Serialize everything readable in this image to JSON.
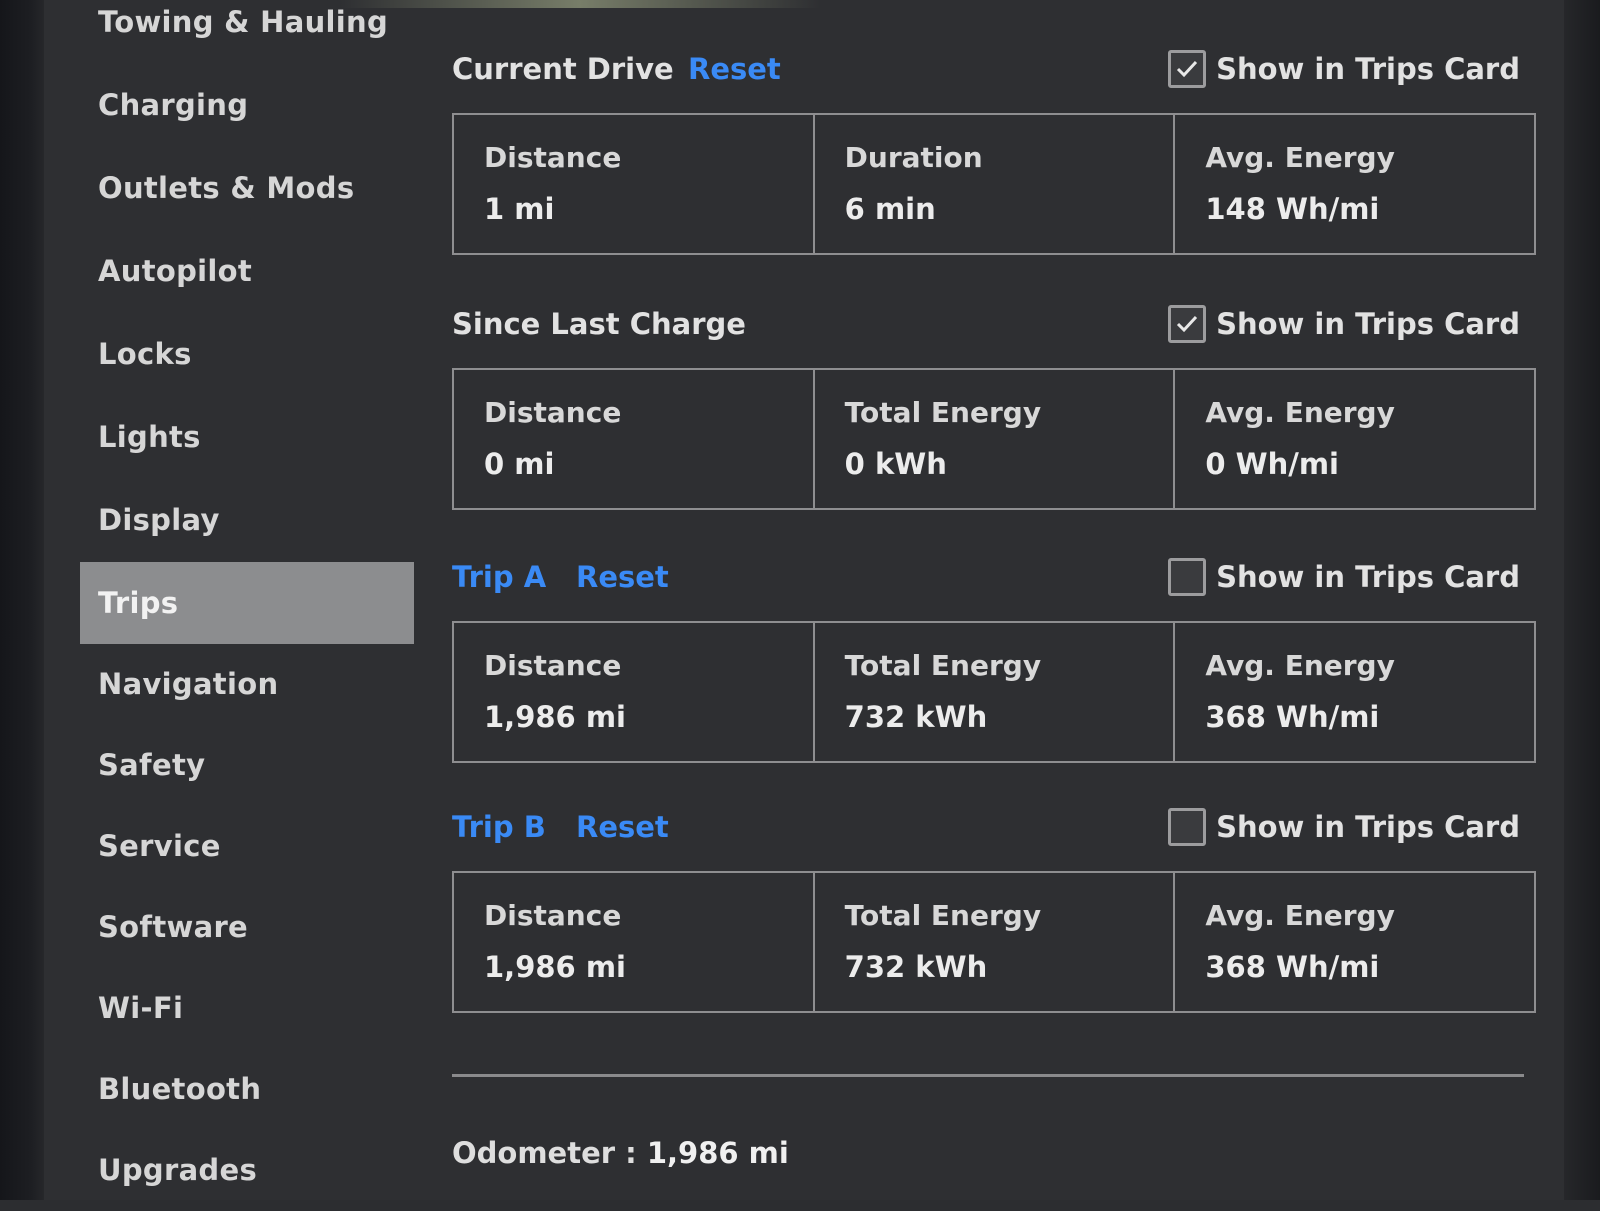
{
  "sidebar": {
    "items": [
      {
        "label": "Towing & Hauling",
        "active": false
      },
      {
        "label": "Charging",
        "active": false
      },
      {
        "label": "Outlets & Mods",
        "active": false
      },
      {
        "label": "Autopilot",
        "active": false
      },
      {
        "label": "Locks",
        "active": false
      },
      {
        "label": "Lights",
        "active": false
      },
      {
        "label": "Display",
        "active": false
      },
      {
        "label": "Trips",
        "active": true
      },
      {
        "label": "Navigation",
        "active": false
      },
      {
        "label": "Safety",
        "active": false
      },
      {
        "label": "Service",
        "active": false
      },
      {
        "label": "Software",
        "active": false
      },
      {
        "label": "Wi-Fi",
        "active": false
      },
      {
        "label": "Bluetooth",
        "active": false
      },
      {
        "label": "Upgrades",
        "active": false
      }
    ]
  },
  "sections": {
    "current_drive": {
      "title": "Current Drive",
      "reset_label": "Reset",
      "show_label": "Show in Trips Card",
      "show_checked": true,
      "stats": [
        {
          "label": "Distance",
          "value": "1 mi"
        },
        {
          "label": "Duration",
          "value": "6 min"
        },
        {
          "label": "Avg. Energy",
          "value": "148 Wh/mi"
        }
      ]
    },
    "since_last_charge": {
      "title": "Since Last Charge",
      "show_label": "Show in Trips Card",
      "show_checked": true,
      "stats": [
        {
          "label": "Distance",
          "value": "0 mi"
        },
        {
          "label": "Total Energy",
          "value": "0 kWh"
        },
        {
          "label": "Avg. Energy",
          "value": "0 Wh/mi"
        }
      ]
    },
    "trip_a": {
      "title": "Trip A",
      "reset_label": "Reset",
      "show_label": "Show in Trips Card",
      "show_checked": false,
      "stats": [
        {
          "label": "Distance",
          "value": "1,986 mi"
        },
        {
          "label": "Total Energy",
          "value": "732 kWh"
        },
        {
          "label": "Avg. Energy",
          "value": "368 Wh/mi"
        }
      ]
    },
    "trip_b": {
      "title": "Trip B",
      "reset_label": "Reset",
      "show_label": "Show in Trips Card",
      "show_checked": false,
      "stats": [
        {
          "label": "Distance",
          "value": "1,986 mi"
        },
        {
          "label": "Total Energy",
          "value": "732 kWh"
        },
        {
          "label": "Avg. Energy",
          "value": "368 Wh/mi"
        }
      ]
    }
  },
  "odometer": {
    "label": "Odometer :",
    "value": "1,986 mi"
  },
  "colors": {
    "accent_blue": "#3a8af5",
    "background": "#2e2f32",
    "active_item": "#8c8d8f",
    "border": "#8e8e90"
  },
  "icons": {
    "checkmark": "check-icon"
  }
}
